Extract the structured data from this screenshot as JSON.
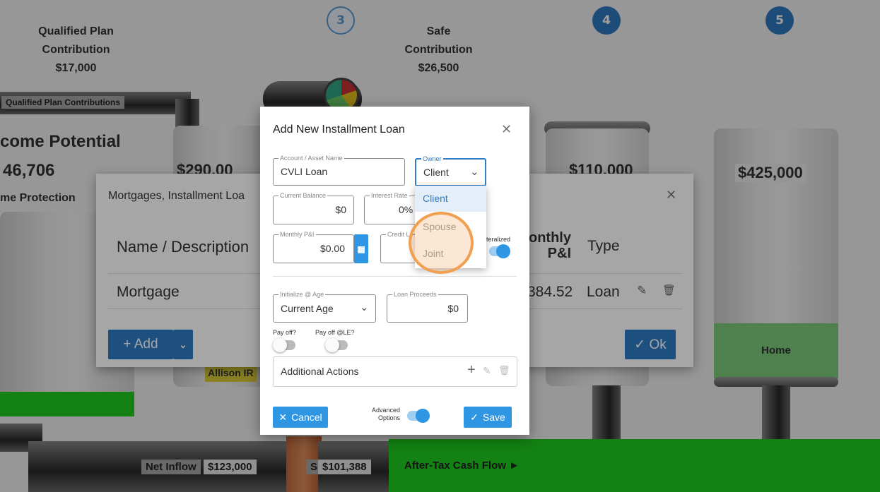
{
  "background": {
    "steps": [
      "3",
      "4",
      "5"
    ],
    "qualified_plan": {
      "title_line1": "Qualified Plan",
      "title_line2": "Contribution",
      "amount": "$17,000"
    },
    "safe_contribution": {
      "title_line1": "Safe",
      "title_line2": "Contribution",
      "amount": "$26,500"
    },
    "qualified_plan_contributions": "Qualified Plan Contributions",
    "income_potential": "come Potential",
    "income_amount": "46,706",
    "income_protection": "me Protection",
    "tank_amount_2": "$290,00",
    "tank_amount_4": "$110,000",
    "tank_amount_5": "$425,000",
    "allison": "Allison IR",
    "home": "Home",
    "net_inflow_label": "Net Inflow",
    "net_inflow_value": "$123,000",
    "si_label": "SI",
    "si_value": "$101,388",
    "after_tax": "After-Tax Cash Flow ►"
  },
  "mortgage_dialog": {
    "title": "Mortgages, Installment Loa",
    "col_name": "Name / Description",
    "col_monthly_1": "onthly",
    "col_monthly_2": "P&I",
    "col_type": "Type",
    "row_name": "Mortgage",
    "row_monthly": "384.52",
    "row_type": "Loan",
    "add_label": "+ Add",
    "ok_label": "✓ Ok"
  },
  "installment_dialog": {
    "title": "Add New Installment Loan",
    "account_label": "Account / Asset Name",
    "account_value": "CVLI Loan",
    "owner_label": "Owner",
    "owner_value": "Client",
    "current_balance_label": "Current Balance",
    "current_balance_value": "$0",
    "interest_rate_label": "Interest Rate",
    "interest_rate_value": "0%",
    "monthly_pi_label": "Monthly P&I",
    "monthly_pi_value": "$0.00",
    "credit_label": "Credit L",
    "collateralized_label": "teralized",
    "initialize_label": "Initialize @ Age",
    "initialize_value": "Current Age",
    "loan_proceeds_label": "Loan Proceeds",
    "loan_proceeds_value": "$0",
    "pay_off_label": "Pay off?",
    "pay_off_le_label": "Pay off @LE?",
    "additional_actions": "Additional Actions",
    "cancel_label": "Cancel",
    "advanced_label_1": "Advanced",
    "advanced_label_2": "Options",
    "save_label": "Save"
  },
  "owner_dropdown": {
    "options": [
      "Client",
      "Spouse",
      "Joint"
    ]
  },
  "colors": {
    "primary": "#2f7bc4",
    "toggle_on": "#2f96e3",
    "highlight": "#f0a050",
    "pipe_green": "#1fd11f"
  }
}
